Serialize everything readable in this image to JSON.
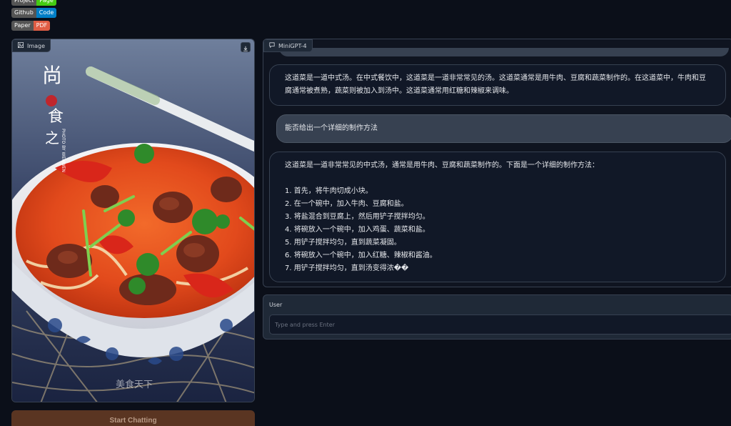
{
  "badges": {
    "project": {
      "left": "Project",
      "right": "Page",
      "color": "#4c1"
    },
    "github": {
      "left": "Github",
      "right": "Code",
      "color": "#007ec6"
    },
    "paper": {
      "left": "Paper",
      "right": "PDF",
      "color": "#e05d44"
    }
  },
  "image_panel": {
    "label": "Image",
    "watermark": "美食天下",
    "image_text": {
      "title_top": "尚",
      "title_mid": "食",
      "title_bottom": "之",
      "side_text": "PHOTO BY WENWEN"
    }
  },
  "start_button": {
    "label": "Start Chatting"
  },
  "chat": {
    "label": "MiniGPT-4",
    "messages": [
      {
        "role": "bot",
        "text": "这道菜是一道中式汤。在中式餐饮中，这道菜是一道非常常见的汤。这道菜通常是用牛肉、豆腐和蔬菜制作的。在这道菜中，牛肉和豆腐通常被煮熟，蔬菜则被加入到汤中。这道菜通常用红糖和辣椒来调味。"
      },
      {
        "role": "user",
        "text": "能否给出一个详细的制作方法"
      },
      {
        "role": "bot",
        "intro": "这道菜是一道非常常见的中式汤，通常是用牛肉、豆腐和蔬菜制作的。下面是一个详细的制作方法：",
        "steps": [
          "1. 首先，将牛肉切成小块。",
          "2. 在一个碗中，加入牛肉、豆腐和盐。",
          "3. 将盐混合到豆腐上，然后用铲子搅拌均匀。",
          "4. 将碗放入一个碗中，加入鸡蛋、蔬菜和盐。",
          "5. 用铲子搅拌均匀，直到蔬菜凝固。",
          "6. 将碗放入一个碗中，加入红糖、辣椒和酱油。",
          "7. 用铲子搅拌均匀，直到汤变得浓��"
        ]
      }
    ]
  },
  "user_input": {
    "label": "User",
    "placeholder": "Type and press Enter"
  },
  "colors": {
    "background": "#0b0f19",
    "accent": "#5a3522"
  }
}
